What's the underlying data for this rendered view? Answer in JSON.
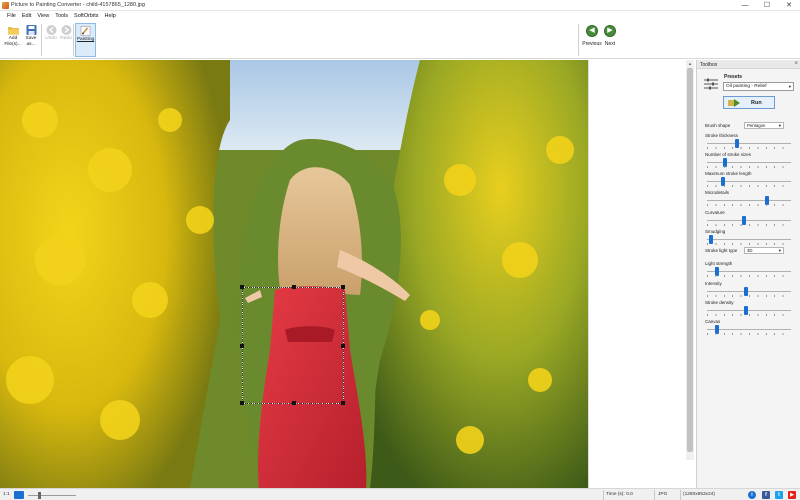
{
  "window": {
    "title": "Picture to Painting Converter - child-4157865_1280.jpg",
    "min_glyph": "—",
    "max_glyph": "☐",
    "close_glyph": "✕"
  },
  "menu": [
    "File",
    "Edit",
    "View",
    "Tools",
    "SoftOrbits",
    "Help"
  ],
  "toolbar": {
    "add_files": {
      "line1": "Add",
      "line2": "File(s)..."
    },
    "save_as": {
      "line1": "Save",
      "line2": "as..."
    },
    "undo": "Undo",
    "redo": "Redo",
    "painting": "Painting",
    "previous": "Previous",
    "next": "Next"
  },
  "toolbox": {
    "title": "Toolbox",
    "close_glyph": "×",
    "presets_label": "Presets",
    "preset_value": "Oil painting - Relief",
    "run_label": "Run",
    "params": [
      {
        "label": "Brush shape",
        "type": "select",
        "value": "Pentagon"
      },
      {
        "label": "Stroke thickness",
        "type": "slider",
        "level": 0.35
      },
      {
        "label": "Number of stroke sizes",
        "type": "slider",
        "level": 0.2
      },
      {
        "label": "Maximum stroke length",
        "type": "slider",
        "level": 0.18
      },
      {
        "label": "Microdetails",
        "type": "slider",
        "level": 0.72
      },
      {
        "label": "Curvature",
        "type": "slider",
        "level": 0.44
      },
      {
        "label": "Smudging",
        "type": "slider",
        "level": 0.02
      },
      {
        "label": "Stroke light type",
        "type": "select",
        "value": "3D"
      },
      {
        "label": "Light strength",
        "type": "slider",
        "level": 0.1
      },
      {
        "label": "Intensity",
        "type": "slider",
        "level": 0.46
      },
      {
        "label": "Stroke density",
        "type": "slider",
        "level": 0.46
      },
      {
        "label": "Canvas",
        "type": "slider",
        "level": 0.1
      }
    ]
  },
  "status": {
    "zoom_label": "1:1",
    "time": "Time (s): 0.0",
    "format": "JPG",
    "dimensions": "(1280x853x24)"
  },
  "colors": {
    "slider_thumb": "#1c6fd2",
    "nav_green": "#4b8a3b",
    "facebook": "#3b5998",
    "twitter": "#1da1f2",
    "youtube": "#e62117"
  }
}
